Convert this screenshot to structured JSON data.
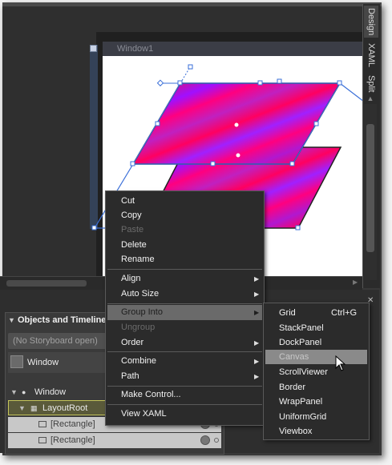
{
  "window": {
    "title": "Window1"
  },
  "view_tabs": [
    "Design",
    "XAML",
    "Split"
  ],
  "objects_panel": {
    "title": "Objects and Timeline",
    "storyboard_label": "(No Storyboard open)",
    "scope_label": "Window",
    "tree": [
      {
        "label": "Window"
      },
      {
        "label": "LayoutRoot"
      },
      {
        "label": "[Rectangle]"
      },
      {
        "label": "[Rectangle]"
      }
    ]
  },
  "context_menu": {
    "items": [
      {
        "label": "Cut",
        "enabled": true
      },
      {
        "label": "Copy",
        "enabled": true
      },
      {
        "label": "Paste",
        "enabled": false
      },
      {
        "label": "Delete",
        "enabled": true
      },
      {
        "label": "Rename",
        "enabled": true
      },
      {
        "label": "Align",
        "enabled": true,
        "submenu": true
      },
      {
        "label": "Auto Size",
        "enabled": true,
        "submenu": true
      },
      {
        "label": "Group Into",
        "enabled": true,
        "submenu": true,
        "highlighted": true
      },
      {
        "label": "Ungroup",
        "enabled": false
      },
      {
        "label": "Order",
        "enabled": true,
        "submenu": true
      },
      {
        "label": "Combine",
        "enabled": true,
        "submenu": true
      },
      {
        "label": "Path",
        "enabled": true,
        "submenu": true
      },
      {
        "label": "Make Control...",
        "enabled": true
      },
      {
        "label": "View XAML",
        "enabled": true
      }
    ]
  },
  "group_into_submenu": {
    "items": [
      {
        "label": "Grid",
        "shortcut": "Ctrl+G"
      },
      {
        "label": "StackPanel"
      },
      {
        "label": "DockPanel"
      },
      {
        "label": "Canvas",
        "highlighted": true
      },
      {
        "label": "ScrollViewer"
      },
      {
        "label": "Border"
      },
      {
        "label": "WrapPanel"
      },
      {
        "label": "UniformGrid"
      },
      {
        "label": "Viewbox"
      }
    ]
  },
  "colors": {
    "gradient_magenta": "#ff007f",
    "gradient_purple": "#a010ff",
    "selection_blue": "#3a6fd8"
  }
}
